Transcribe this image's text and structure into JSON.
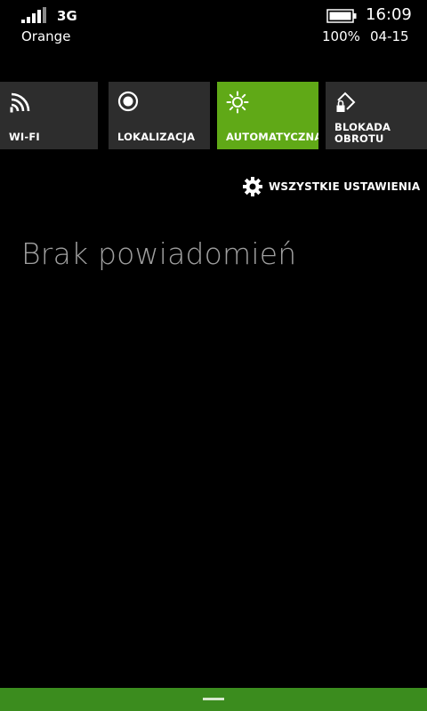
{
  "status_bar": {
    "network_type": "3G",
    "carrier": "Orange",
    "time": "16:09",
    "battery_percent": "100%",
    "date": "04-15",
    "signal_icon": "signal-bars-icon",
    "battery_icon": "battery-icon"
  },
  "quick_actions": [
    {
      "label": "WI-FI",
      "icon": "wifi-icon",
      "active": false
    },
    {
      "label": "LOKALIZACJA",
      "icon": "location-icon",
      "active": false
    },
    {
      "label": "AUTOMATYCZNA",
      "icon": "brightness-icon",
      "active": true
    },
    {
      "label": "BLOKADA OBROTU",
      "icon": "rotation-lock-icon",
      "active": false
    }
  ],
  "all_settings": {
    "label": "WSZYSTKIE USTAWIENIA",
    "icon": "gear-icon"
  },
  "notifications": {
    "empty_message": "Brak powiadomień"
  },
  "colors": {
    "accent": "#60a917",
    "bottom_bar": "#3b8c1e",
    "tile_background": "#2d2d2d",
    "muted_text": "#a0a0a0"
  }
}
